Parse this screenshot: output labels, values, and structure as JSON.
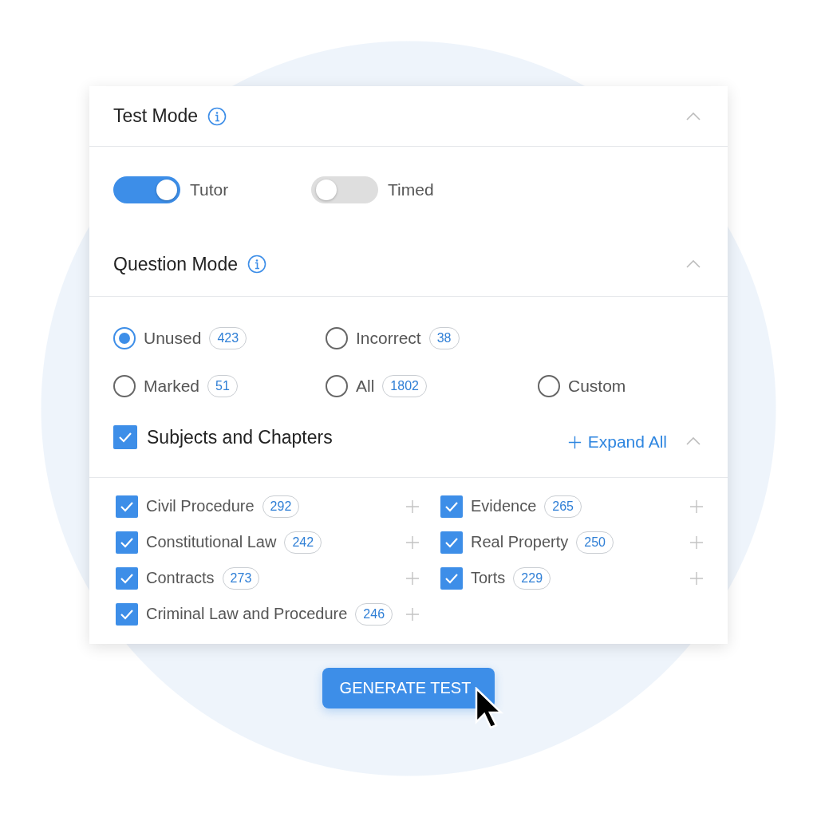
{
  "test_mode": {
    "title": "Test Mode",
    "expanded": true,
    "toggles": [
      {
        "label": "Tutor",
        "on": true
      },
      {
        "label": "Timed",
        "on": false
      }
    ]
  },
  "question_mode": {
    "title": "Question Mode",
    "expanded": true,
    "rows": [
      [
        {
          "label": "Unused",
          "count": "423",
          "selected": true
        },
        {
          "label": "Incorrect",
          "count": "38",
          "selected": false
        }
      ],
      [
        {
          "label": "Marked",
          "count": "51",
          "selected": false
        },
        {
          "label": "All",
          "count": "1802",
          "selected": false
        },
        {
          "label": "Custom",
          "selected": false
        }
      ]
    ]
  },
  "subjects": {
    "title": "Subjects and Chapters",
    "checked": true,
    "expand_label": "Expand All",
    "expanded": true,
    "columns": [
      [
        {
          "label": "Civil Procedure",
          "count": "292",
          "checked": true
        },
        {
          "label": "Constitutional Law",
          "count": "242",
          "checked": true
        },
        {
          "label": "Contracts",
          "count": "273",
          "checked": true
        },
        {
          "label": "Criminal Law and Procedure",
          "count": "246",
          "checked": true
        }
      ],
      [
        {
          "label": "Evidence",
          "count": "265",
          "checked": true
        },
        {
          "label": "Real Property",
          "count": "250",
          "checked": true
        },
        {
          "label": "Torts",
          "count": "229",
          "checked": true
        }
      ]
    ]
  },
  "action": {
    "label": "GENERATE TEST"
  }
}
